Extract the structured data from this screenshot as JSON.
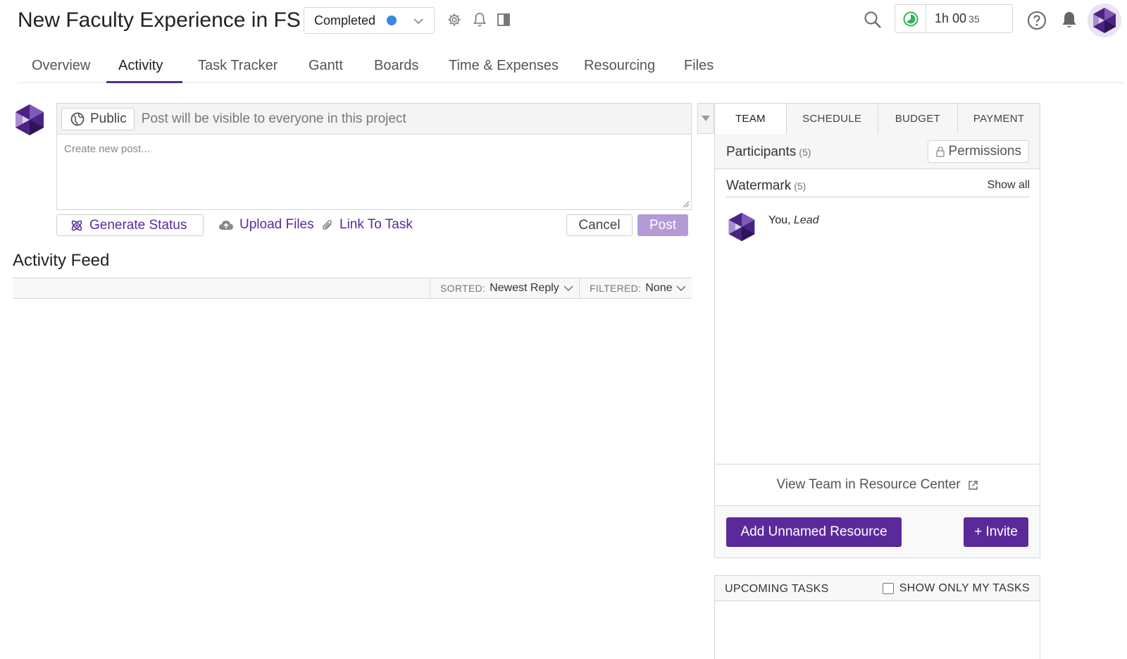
{
  "header": {
    "title": "New Faculty Experience in FS",
    "status": "Completed",
    "status_color": "#3a86e0",
    "timer": {
      "hm": "1h 00",
      "sec": "35"
    }
  },
  "tabs": [
    {
      "label": "Overview"
    },
    {
      "label": "Activity"
    },
    {
      "label": "Task Tracker"
    },
    {
      "label": "Gantt"
    },
    {
      "label": "Boards"
    },
    {
      "label": "Time & Expenses"
    },
    {
      "label": "Resourcing"
    },
    {
      "label": "Files"
    }
  ],
  "active_tab": "Activity",
  "composer": {
    "visibility_label": "Public",
    "visibility_hint": "Post will be visible to everyone in this project",
    "placeholder": "Create new post...",
    "generate_status": "Generate Status",
    "upload_files": "Upload Files",
    "link_to_task": "Link To Task",
    "cancel": "Cancel",
    "post": "Post"
  },
  "feed": {
    "title": "Activity Feed",
    "sorted_label": "SORTED:",
    "sorted_value": "Newest Reply",
    "filtered_label": "FILTERED:",
    "filtered_value": "None"
  },
  "right_panel": {
    "tabs": [
      "TEAM",
      "SCHEDULE",
      "BUDGET",
      "PAYMENT"
    ],
    "participants_label": "Participants",
    "participants_count": "(5)",
    "permissions": "Permissions",
    "group_label": "Watermark",
    "group_count": "(5)",
    "show_all": "Show all",
    "member_name": "You,",
    "member_role": "Lead",
    "view_team": "View Team in Resource Center",
    "add_unnamed": "Add Unnamed Resource",
    "invite": "+ Invite"
  },
  "upcoming": {
    "title": "UPCOMING TASKS",
    "show_only_mine": "SHOW ONLY MY TASKS"
  },
  "colors": {
    "brand": "#5b2a9a",
    "post_disabled": "#b49bd6",
    "timer_green": "#2fb35a"
  }
}
